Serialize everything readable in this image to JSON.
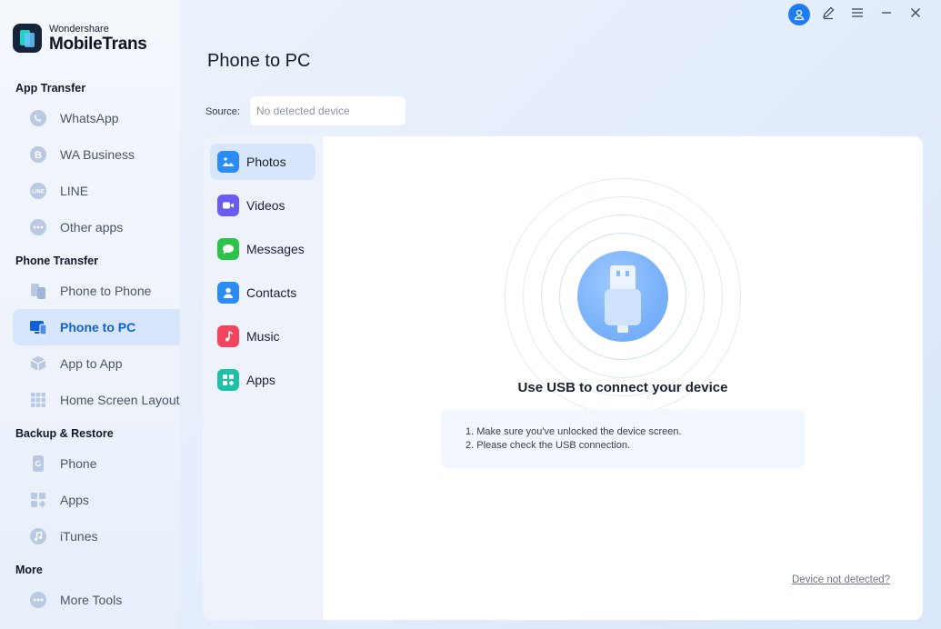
{
  "app": {
    "brand_top": "Wondershare",
    "brand_bottom": "MobileTrans"
  },
  "window_controls": {
    "icons": [
      "user-icon",
      "edit-icon",
      "menu-icon",
      "minimize-icon",
      "close-icon"
    ]
  },
  "sidebar": {
    "sections": [
      {
        "title": "App Transfer",
        "items": [
          {
            "label": "WhatsApp",
            "icon": "whatsapp-icon"
          },
          {
            "label": "WA Business",
            "icon": "wa-business-icon"
          },
          {
            "label": "LINE",
            "icon": "line-icon"
          },
          {
            "label": "Other apps",
            "icon": "more-dots-icon"
          }
        ]
      },
      {
        "title": "Phone Transfer",
        "items": [
          {
            "label": "Phone to Phone",
            "icon": "phone-to-phone-icon"
          },
          {
            "label": "Phone to PC",
            "icon": "phone-to-pc-icon",
            "active": true
          },
          {
            "label": "App to App",
            "icon": "app-to-app-icon"
          },
          {
            "label": "Home Screen Layout",
            "icon": "grid-icon"
          }
        ]
      },
      {
        "title": "Backup & Restore",
        "items": [
          {
            "label": "Phone",
            "icon": "phone-backup-icon"
          },
          {
            "label": "Apps",
            "icon": "apps-icon"
          },
          {
            "label": "iTunes",
            "icon": "itunes-icon"
          }
        ]
      },
      {
        "title": "More",
        "items": [
          {
            "label": "More Tools",
            "icon": "more-dots-icon"
          }
        ]
      }
    ]
  },
  "main": {
    "title": "Phone to PC",
    "source_label": "Source:",
    "source_value": "No detected device",
    "categories": [
      {
        "label": "Photos",
        "icon": "photos-icon",
        "color": "#2b8cf5",
        "active": true
      },
      {
        "label": "Videos",
        "icon": "videos-icon",
        "color": "#6a5cf0"
      },
      {
        "label": "Messages",
        "icon": "messages-icon",
        "color": "#2fc24b"
      },
      {
        "label": "Contacts",
        "icon": "contacts-icon",
        "color": "#2b8cf5"
      },
      {
        "label": "Music",
        "icon": "music-icon",
        "color": "#f2455d"
      },
      {
        "label": "Apps",
        "icon": "apps-icon",
        "color": "#1fbfa8"
      }
    ],
    "connect_title": "Use USB to connect your device",
    "tips": [
      "1. Make sure you've unlocked the device screen.",
      "2. Please check the USB connection."
    ],
    "not_detected_link": "Device not detected?"
  },
  "colors": {
    "accent": "#1161d8",
    "active_bg": "#d7e6fb"
  }
}
